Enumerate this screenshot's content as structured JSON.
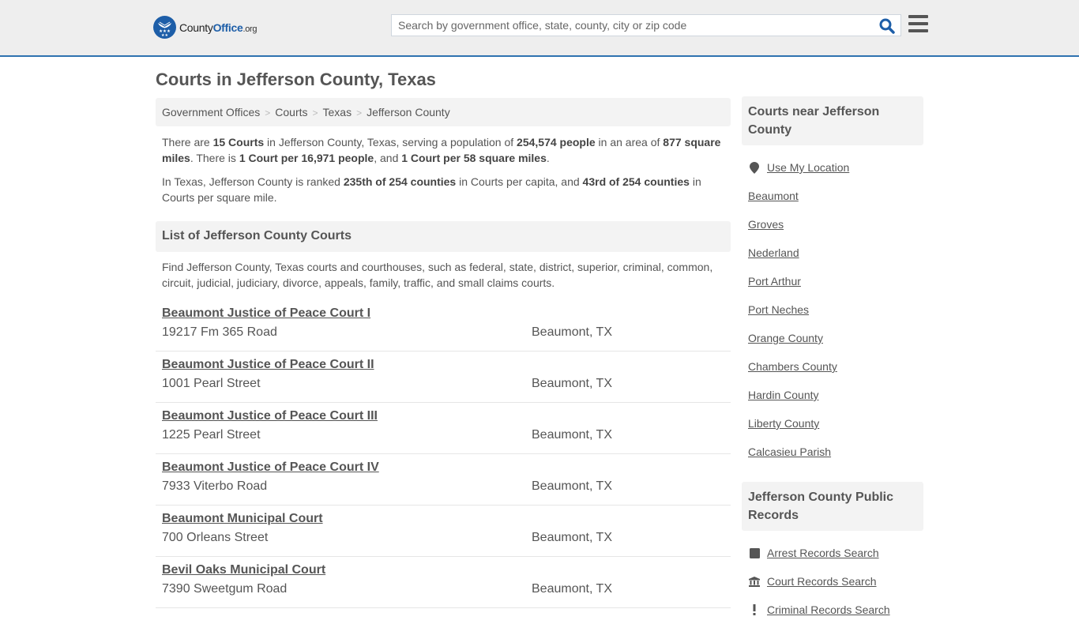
{
  "header": {
    "logo": {
      "part1": "County",
      "part2": "Office",
      "part3": ".org"
    },
    "search": {
      "placeholder": "Search by government office, state, county, city or zip code",
      "value": ""
    },
    "search_icon": "search-icon",
    "menu_icon": "hamburger-menu-icon",
    "accent_color": "#1d5ea8",
    "border_color": "#2f73b0"
  },
  "page": {
    "title": "Courts in Jefferson County, Texas"
  },
  "breadcrumb": [
    {
      "label": "Government Offices"
    },
    {
      "label": "Courts"
    },
    {
      "label": "Texas"
    },
    {
      "label": "Jefferson County"
    }
  ],
  "breadcrumb_separator": ">",
  "intro": {
    "p1": {
      "t1": "There are ",
      "b1": "15 Courts",
      "t2": " in Jefferson County, Texas, serving a population of ",
      "b2": "254,574 people",
      "t3": " in an area of ",
      "b3": "877 square miles",
      "t4": ". There is ",
      "b4": "1 Court per 16,971 people",
      "t5": ", and ",
      "b5": "1 Court per 58 square miles",
      "t6": "."
    },
    "p2": {
      "t1": "In Texas, Jefferson County is ranked ",
      "b1": "235th of 254 counties",
      "t2": " in Courts per capita, and ",
      "b2": "43rd of 254 counties",
      "t3": " in Courts per square mile."
    }
  },
  "list": {
    "heading": "List of Jefferson County Courts",
    "description": "Find Jefferson County, Texas courts and courthouses, such as federal, state, district, superior, criminal, common, circuit, judicial, judiciary, divorce, appeals, family, traffic, and small claims courts.",
    "courts": [
      {
        "name": "Beaumont Justice of Peace Court I",
        "address": "19217 Fm 365 Road",
        "city": "Beaumont, TX"
      },
      {
        "name": "Beaumont Justice of Peace Court II",
        "address": "1001 Pearl Street",
        "city": "Beaumont, TX"
      },
      {
        "name": "Beaumont Justice of Peace Court III",
        "address": "1225 Pearl Street",
        "city": "Beaumont, TX"
      },
      {
        "name": "Beaumont Justice of Peace Court IV",
        "address": "7933 Viterbo Road",
        "city": "Beaumont, TX"
      },
      {
        "name": "Beaumont Municipal Court",
        "address": "700 Orleans Street",
        "city": "Beaumont, TX"
      },
      {
        "name": "Bevil Oaks Municipal Court",
        "address": "7390 Sweetgum Road",
        "city": "Beaumont, TX"
      }
    ]
  },
  "sidebar": {
    "nearby": {
      "heading": "Courts near Jefferson County",
      "use_location": "Use My Location",
      "items": [
        {
          "label": "Beaumont"
        },
        {
          "label": "Groves"
        },
        {
          "label": "Nederland"
        },
        {
          "label": "Port Arthur"
        },
        {
          "label": "Port Neches"
        },
        {
          "label": "Orange County"
        },
        {
          "label": "Chambers County"
        },
        {
          "label": "Hardin County"
        },
        {
          "label": "Liberty County"
        },
        {
          "label": "Calcasieu Parish"
        }
      ]
    },
    "records": {
      "heading": "Jefferson County Public Records",
      "items": [
        {
          "label": "Arrest Records Search",
          "icon": "square-icon"
        },
        {
          "label": "Court Records Search",
          "icon": "courthouse-icon"
        },
        {
          "label": "Criminal Records Search",
          "icon": "exclamation-icon"
        }
      ]
    }
  }
}
